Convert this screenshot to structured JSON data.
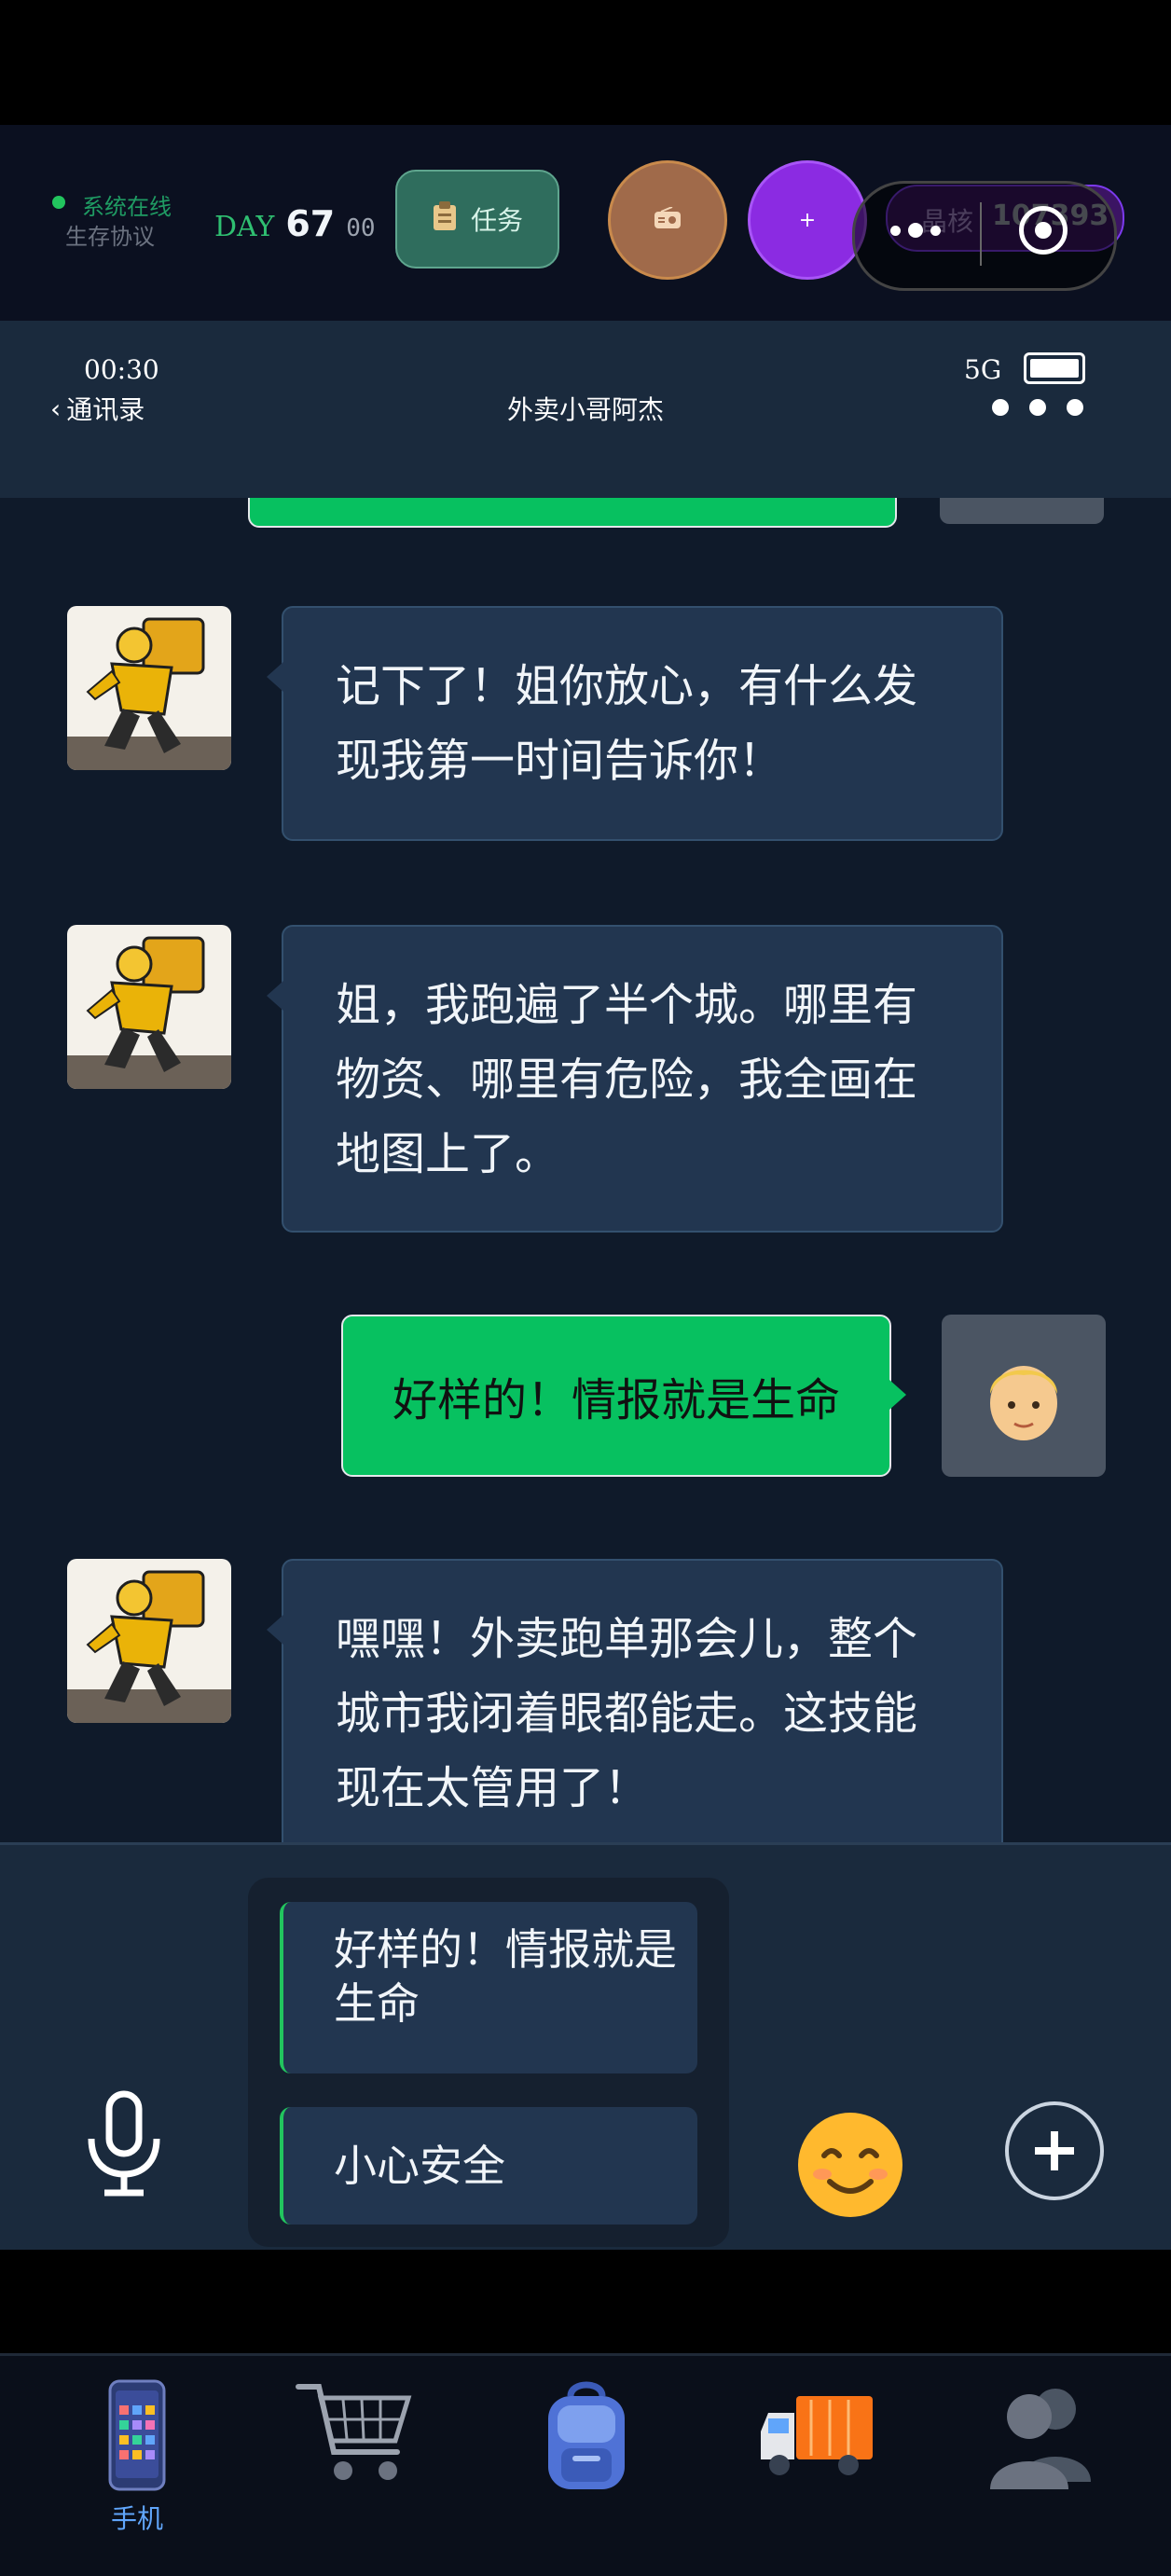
{
  "hud": {
    "status_text": "系统在线",
    "protocol_text": "生存协议",
    "day_label": "DAY",
    "day_value": "67",
    "day_suffix": "00",
    "task_label": "任务",
    "plus_label": "+",
    "crystal_label": "晶核",
    "crystal_value": "107393"
  },
  "status_bar": {
    "time": "00:30",
    "network": "5G"
  },
  "chat_header": {
    "back_label": "通讯录",
    "title": "外卖小哥阿杰"
  },
  "messages": [
    {
      "from": "contact",
      "text": "记下了！姐你放心，有什么发现我第一时间告诉你！"
    },
    {
      "from": "contact",
      "text": "姐，我跑遍了半个城。哪里有物资、哪里有危险，我全画在地图上了。"
    },
    {
      "from": "me",
      "text": "好样的！情报就是生命"
    },
    {
      "from": "contact",
      "text": "嘿嘿！外卖跑单那会儿，整个城市我闭着眼都能走。这技能现在太管用了！"
    }
  ],
  "quick_replies": [
    "好样的！情报就是生命",
    "小心安全"
  ],
  "bottom_nav": {
    "phone_label": "手机"
  },
  "colors": {
    "accent_green": "#07c160",
    "bubble": "#223650",
    "header": "#1a2a3d"
  }
}
